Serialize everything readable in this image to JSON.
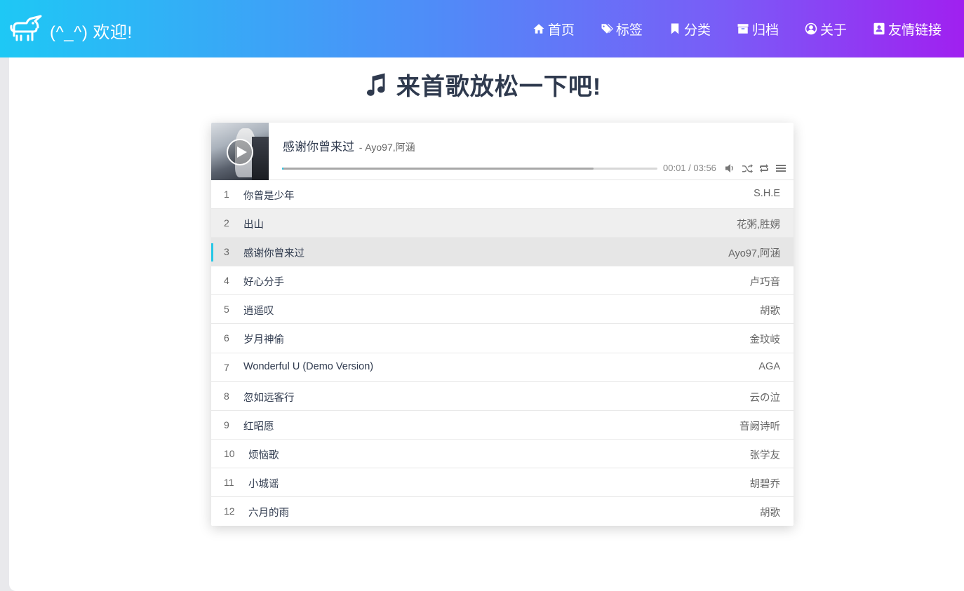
{
  "header": {
    "brand_text": "(^_^) 欢迎!",
    "nav": [
      {
        "label": "首页",
        "icon": "home-icon"
      },
      {
        "label": "标签",
        "icon": "tags-icon"
      },
      {
        "label": "分类",
        "icon": "bookmark-icon"
      },
      {
        "label": "归档",
        "icon": "archive-icon"
      },
      {
        "label": "关于",
        "icon": "user-circle-icon"
      },
      {
        "label": "友情链接",
        "icon": "address-book-icon"
      }
    ]
  },
  "page": {
    "title": "来首歌放松一下吧!",
    "title_icon": "music-note-icon"
  },
  "player": {
    "now_playing": {
      "title": "感谢你曾来过",
      "artist": "- Ayo97,阿涵",
      "time": "00:01 / 03:56",
      "played_fraction": 0.004,
      "loaded_fraction": 0.83
    },
    "controls": [
      "volume-icon",
      "shuffle-icon",
      "loop-icon",
      "playlist-menu-icon"
    ],
    "playlist": [
      {
        "num": "1",
        "title": "你曾是少年",
        "artist": "S.H.E"
      },
      {
        "num": "2",
        "title": "出山",
        "artist": "花粥,胜娚"
      },
      {
        "num": "3",
        "title": "感谢你曾来过",
        "artist": "Ayo97,阿涵"
      },
      {
        "num": "4",
        "title": "好心分手",
        "artist": "卢巧音"
      },
      {
        "num": "5",
        "title": "逍遥叹",
        "artist": "胡歌"
      },
      {
        "num": "6",
        "title": "岁月神偷",
        "artist": "金玟岐"
      },
      {
        "num": "7",
        "title": "Wonderful U (Demo Version)",
        "artist": "AGA"
      },
      {
        "num": "8",
        "title": "忽如远客行",
        "artist": "云の泣"
      },
      {
        "num": "9",
        "title": "红昭愿",
        "artist": "音阙诗听"
      },
      {
        "num": "10",
        "title": "烦恼歌",
        "artist": "张学友"
      },
      {
        "num": "11",
        "title": "小城谣",
        "artist": "胡碧乔"
      },
      {
        "num": "12",
        "title": "六月的雨",
        "artist": "胡歌"
      }
    ]
  },
  "colors": {
    "header_gradient_start": "#1ec8f5",
    "header_gradient_end": "#a020f0",
    "accent": "#27c7e6",
    "title_text": "#2f3a4e"
  }
}
